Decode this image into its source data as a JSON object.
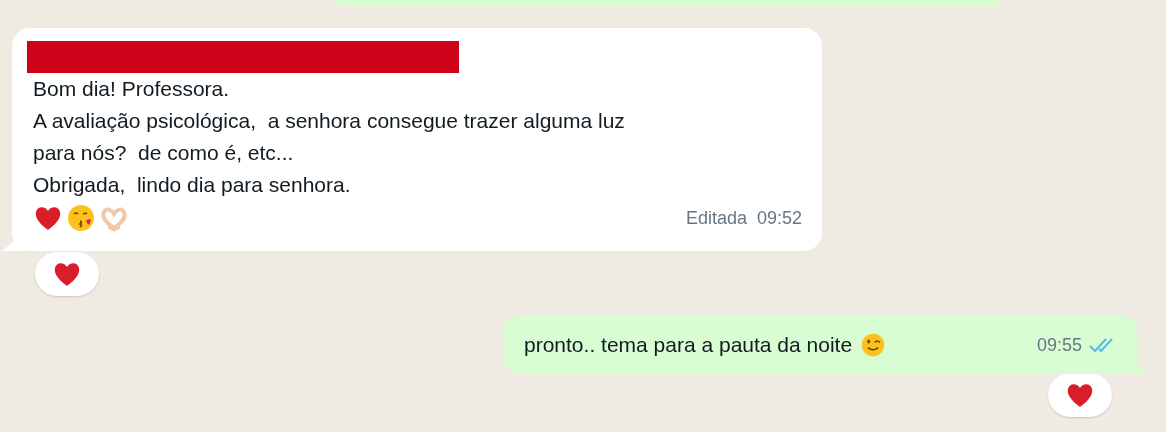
{
  "previous_message": {
    "kind": "outgoing"
  },
  "incoming": {
    "sender_redacted": true,
    "lines": [
      "Bom dia! Professora.",
      "A avaliação psicológica,  a senhora consegue trazer alguma luz",
      "para nós?  de como é, etc...",
      "Obrigada,  lindo dia para senhora."
    ],
    "emojis": [
      {
        "kind": "heart"
      },
      {
        "kind": "kiss"
      },
      {
        "kind": "heart_hands"
      }
    ],
    "edited_label": "Editada",
    "time": "09:52",
    "reaction": {
      "kind": "heart"
    }
  },
  "outgoing": {
    "text": "pronto.. tema para a pauta da noite",
    "emoji": {
      "kind": "wink"
    },
    "time": "09:55",
    "read": true,
    "reaction": {
      "kind": "heart"
    }
  }
}
